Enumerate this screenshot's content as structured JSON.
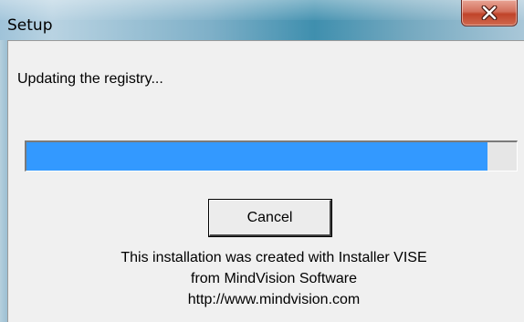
{
  "window": {
    "title": "Setup"
  },
  "status": {
    "text": "Updating the registry..."
  },
  "progress": {
    "percent": 94,
    "fill_color": "#3399ff"
  },
  "buttons": {
    "cancel_label": "Cancel"
  },
  "credits": {
    "line1": "This installation was created with Installer VISE",
    "line2": "from MindVision Software",
    "line3": "http://www.mindvision.com"
  },
  "icons": {
    "close": "close-icon"
  }
}
